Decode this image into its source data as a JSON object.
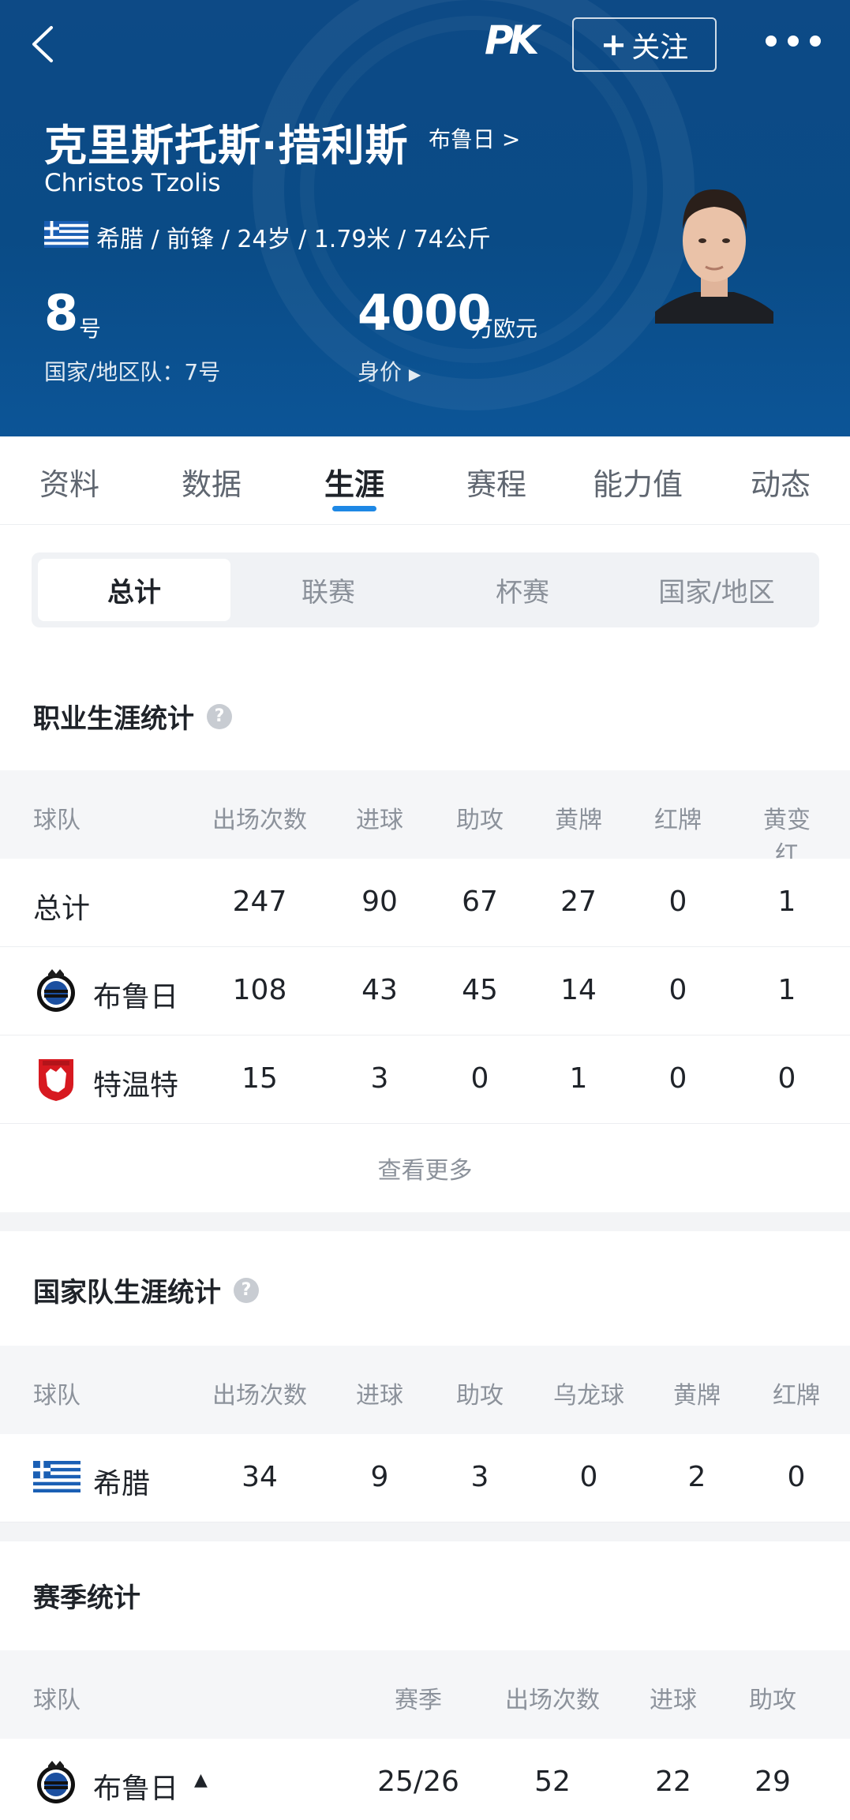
{
  "header": {
    "follow_label": "关注",
    "logo_text": "PK",
    "name_cn": "克里斯托斯·措利斯",
    "club_link": "布鲁日 >",
    "name_en": "Christos Tzolis",
    "bio": "希腊 / 前锋 / 24岁 / 1.79米 / 74公斤",
    "shirt_number": "8",
    "shirt_unit": "号",
    "national_number": "国家/地区队：7号",
    "market_value": "4000",
    "market_value_unit": "万欧元",
    "market_value_label": "身价"
  },
  "tabs": [
    {
      "label": "资料"
    },
    {
      "label": "数据"
    },
    {
      "label": "生涯",
      "active": true
    },
    {
      "label": "赛程"
    },
    {
      "label": "能力值"
    },
    {
      "label": "动态"
    }
  ],
  "segments": [
    {
      "label": "总计",
      "active": true
    },
    {
      "label": "联赛"
    },
    {
      "label": "杯赛"
    },
    {
      "label": "国家/地区"
    }
  ],
  "career": {
    "title": "职业生涯统计",
    "headers": [
      "球队",
      "出场次数",
      "进球",
      "助攻",
      "黄牌",
      "红牌",
      "黄变红"
    ],
    "rows": [
      {
        "team": "总计",
        "apps": "247",
        "goals": "90",
        "assists": "67",
        "yellow": "27",
        "red": "0",
        "yellow_red": "1"
      },
      {
        "team": "布鲁日",
        "apps": "108",
        "goals": "43",
        "assists": "45",
        "yellow": "14",
        "red": "0",
        "yellow_red": "1"
      },
      {
        "team": "特温特",
        "apps": "15",
        "goals": "3",
        "assists": "0",
        "yellow": "1",
        "red": "0",
        "yellow_red": "0"
      }
    ],
    "more_label": "查看更多"
  },
  "national": {
    "title": "国家队生涯统计",
    "headers": [
      "球队",
      "出场次数",
      "进球",
      "助攻",
      "乌龙球",
      "黄牌",
      "红牌"
    ],
    "rows": [
      {
        "team": "希腊",
        "apps": "34",
        "goals": "9",
        "assists": "3",
        "own_goals": "0",
        "yellow": "2",
        "red": "0"
      }
    ]
  },
  "season": {
    "title": "赛季统计",
    "headers": [
      "球队",
      "赛季",
      "出场次数",
      "进球",
      "助攻"
    ],
    "rows": [
      {
        "team": "布鲁日",
        "season": "25/26",
        "apps": "52",
        "goals": "22",
        "assists": "29"
      }
    ]
  },
  "colors": {
    "hero_bg": "#0a4b86",
    "accent": "#1e88e5"
  }
}
